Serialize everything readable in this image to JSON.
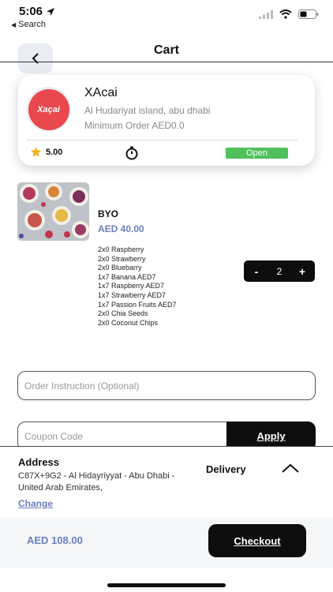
{
  "status_bar": {
    "time": "5:06",
    "back_app": "Search",
    "icons": [
      "location-arrow-icon",
      "signal-icon",
      "wifi-icon",
      "battery-icon"
    ]
  },
  "header": {
    "title": "Cart",
    "back_icon": "chevron-left-icon"
  },
  "store": {
    "logo_text": "Xaçai",
    "name": "XAcai",
    "address": "Al Hudariyat island, abu dhabi",
    "minimum_order": "Minimum Order AED0.0",
    "rating": "5.00",
    "status": "Open"
  },
  "cart_item": {
    "name": "BYO",
    "price": "AED 40.00",
    "options": [
      "2x0 Raspberry",
      "2x0 Strawberry",
      "2x0 Bluebarry",
      "1x7 Banana  AED7",
      "1x7 Raspberry  AED7",
      "1x7 Strawberry AED7",
      "1x7 Passion Fruits  AED7",
      "2x0 Chia Seeds",
      "2x0 Coconut Chips"
    ],
    "quantity": "2",
    "decrement_label": "-",
    "increment_label": "+"
  },
  "instruction": {
    "placeholder": "Order Instruction (Optional)"
  },
  "coupon": {
    "placeholder": "Coupon Code",
    "apply_label": "Apply"
  },
  "bottom": {
    "address_title": "Address",
    "address_text": "C87X+9G2 - Al Hidayriyyat - Abu Dhabi - United Arab Emirates,",
    "change_label": "Change",
    "delivery_label": "Delivery",
    "total": "AED 108.00",
    "checkout_label": "Checkout"
  },
  "colors": {
    "accent_blue": "#6b7fbf",
    "open_green": "#50c05c",
    "brand_red": "#e8484e",
    "button_black": "#0d0d0d"
  }
}
